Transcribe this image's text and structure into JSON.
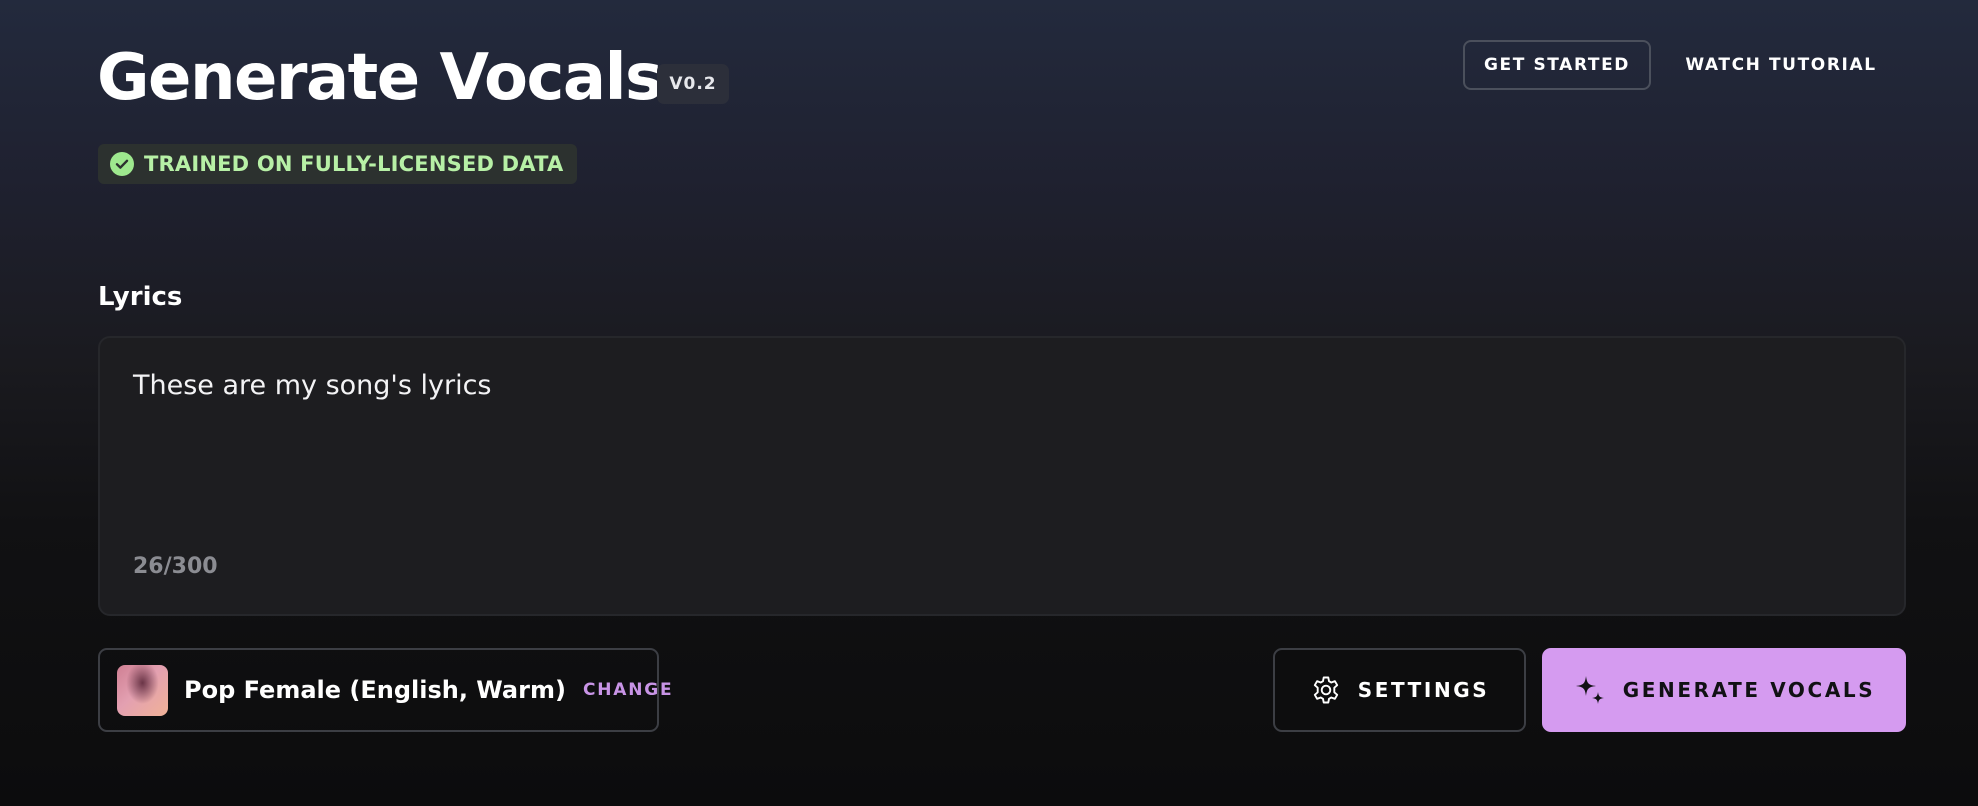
{
  "header": {
    "title": "Generate Vocals",
    "version": "V0.2",
    "licensed_badge": "TRAINED ON FULLY-LICENSED DATA",
    "get_started_label": "GET STARTED",
    "watch_tutorial_label": "WATCH TUTORIAL"
  },
  "lyrics": {
    "label": "Lyrics",
    "value": "These are my song's lyrics",
    "count": "26/300"
  },
  "voice": {
    "name": "Pop Female (English, Warm)",
    "change_label": "CHANGE"
  },
  "actions": {
    "settings_label": "SETTINGS",
    "generate_label": "GENERATE VOCALS"
  },
  "colors": {
    "accent": "#d59bf0",
    "badge_text": "#b7f0a6",
    "badge_check": "#9ee88e",
    "change_link": "#c894e6"
  },
  "icons": {
    "badge": "check-circle-icon",
    "settings": "gear-icon",
    "generate": "sparkle-icon"
  }
}
